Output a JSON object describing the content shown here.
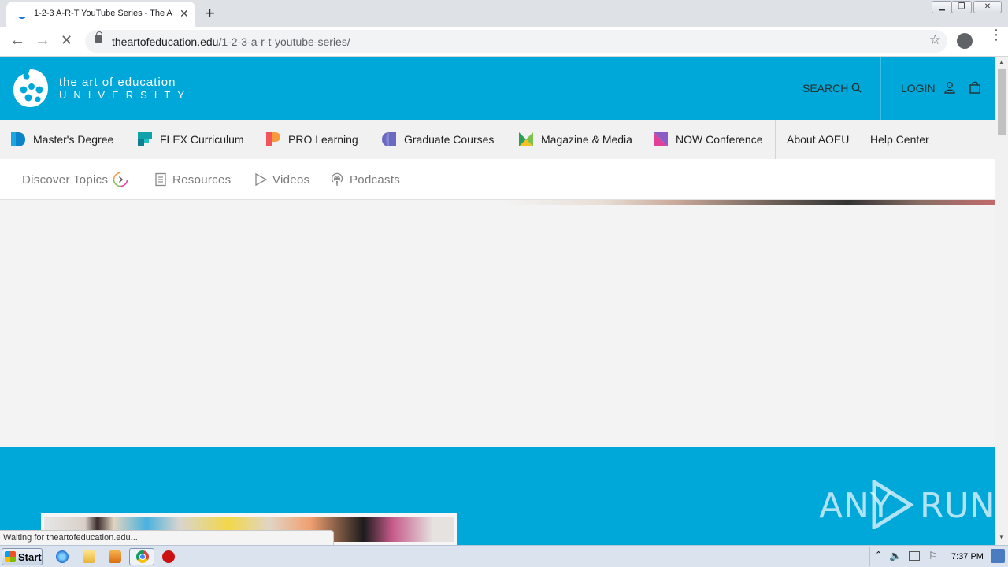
{
  "browser": {
    "tab_title": "1-2-3 A-R-T YouTube Series - The A",
    "new_tab_label": "+",
    "url_domain": "theartofeducation.edu",
    "url_path": "/1-2-3-a-r-t-youtube-series/"
  },
  "site": {
    "logo_line1": "the art of education",
    "logo_line2": "UNIVERSITY",
    "search_label": "SEARCH",
    "login_label": "LOGIN",
    "main_nav": [
      {
        "label": "Master's Degree",
        "color": "#0a83c9"
      },
      {
        "label": "FLEX Curriculum",
        "color": "#0fa3a9"
      },
      {
        "label": "PRO Learning",
        "color": "#f06b4a"
      },
      {
        "label": "Graduate Courses",
        "color": "#6a6bbf"
      },
      {
        "label": "Magazine & Media",
        "color": "#7cc24a"
      },
      {
        "label": "NOW Conference",
        "color": "#e0409a"
      },
      {
        "label": "About AOEU"
      },
      {
        "label": "Help Center"
      }
    ],
    "sub_nav": [
      {
        "label": "Discover Topics"
      },
      {
        "label": "Resources"
      },
      {
        "label": "Videos"
      },
      {
        "label": "Podcasts"
      }
    ],
    "brand_color": "#00a7d9"
  },
  "status_text": "Waiting for theartofeducation.edu...",
  "watermark": {
    "left": "ANY",
    "right": "RUN"
  },
  "taskbar": {
    "start_label": "Start",
    "clock": "7:37 PM"
  }
}
